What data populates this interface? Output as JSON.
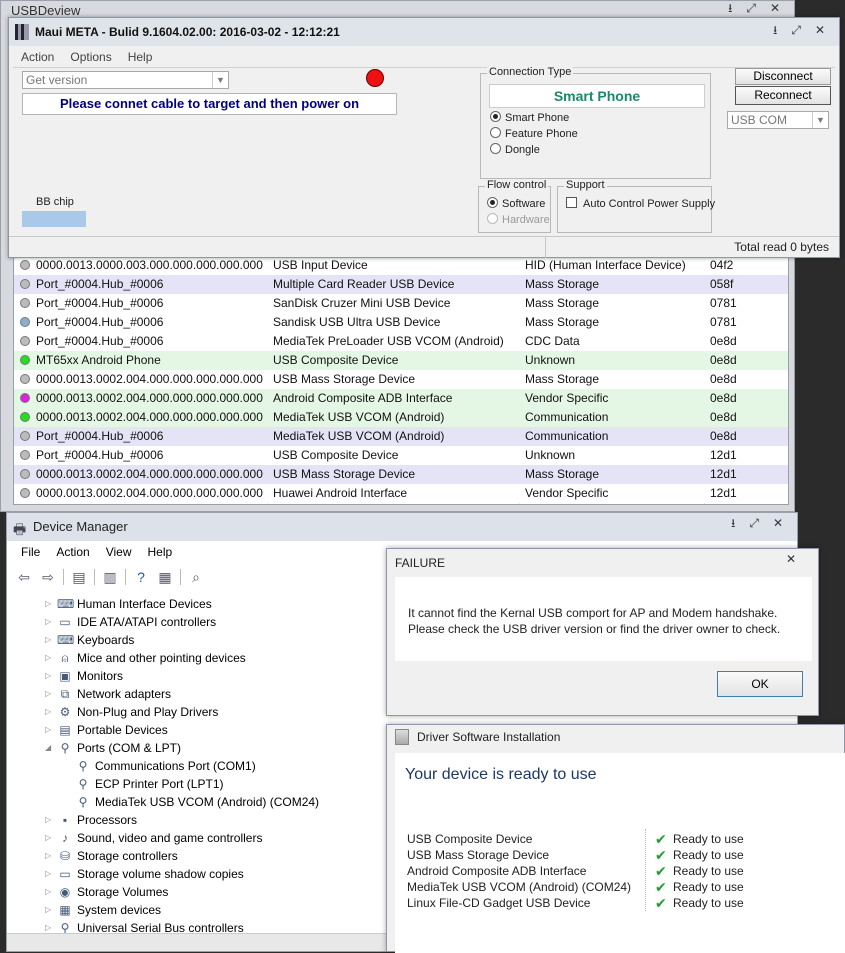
{
  "usbdeview": {
    "title": "USBDeview",
    "caption": {
      "min": "⭳",
      "restore": "⤢",
      "close": "✕"
    },
    "rows": [
      {
        "c1": "0000.0013.0000.003.000.000.000.000.000",
        "c2": "USB Input Device",
        "c3": "HID (Human Interface Device)",
        "c4": "04f2",
        "dot": "#bbbbbb",
        "bg": "#ffffff"
      },
      {
        "c1": "Port_#0004.Hub_#0006",
        "c2": "Multiple Card  Reader USB Device",
        "c3": "Mass Storage",
        "c4": "058f",
        "dot": "#bbbbbb",
        "bg": "#e4e4f6"
      },
      {
        "c1": "Port_#0004.Hub_#0006",
        "c2": "SanDisk Cruzer Mini USB Device",
        "c3": "Mass Storage",
        "c4": "0781",
        "dot": "#bbbbbb",
        "bg": "#ffffff"
      },
      {
        "c1": "Port_#0004.Hub_#0006",
        "c2": "Sandisk USB Ultra USB Device",
        "c3": "Mass Storage",
        "c4": "0781",
        "dot": "#8ab0cc",
        "bg": "#ffffff"
      },
      {
        "c1": "Port_#0004.Hub_#0006",
        "c2": "MediaTek PreLoader USB VCOM (Android)",
        "c3": "CDC Data",
        "c4": "0e8d",
        "dot": "#bbbbbb",
        "bg": "#ffffff"
      },
      {
        "c1": "MT65xx Android Phone",
        "c2": "USB Composite Device",
        "c3": "Unknown",
        "c4": "0e8d",
        "dot": "#22dd22",
        "bg": "#e4f7e4"
      },
      {
        "c1": "0000.0013.0002.004.000.000.000.000.000",
        "c2": "USB Mass Storage Device",
        "c3": "Mass Storage",
        "c4": "0e8d",
        "dot": "#bbbbbb",
        "bg": "#ffffff"
      },
      {
        "c1": "0000.0013.0002.004.000.000.000.000.000",
        "c2": "Android Composite ADB Interface",
        "c3": "Vendor Specific",
        "c4": "0e8d",
        "dot": "#dd22dd",
        "bg": "#e4f7e4"
      },
      {
        "c1": "0000.0013.0002.004.000.000.000.000.000",
        "c2": "MediaTek USB VCOM (Android)",
        "c3": "Communication",
        "c4": "0e8d",
        "dot": "#22dd22",
        "bg": "#e4f7e4"
      },
      {
        "c1": "Port_#0004.Hub_#0006",
        "c2": "MediaTek USB VCOM (Android)",
        "c3": "Communication",
        "c4": "0e8d",
        "dot": "#bbbbbb",
        "bg": "#e4e4f6"
      },
      {
        "c1": "Port_#0004.Hub_#0006",
        "c2": "USB Composite Device",
        "c3": "Unknown",
        "c4": "12d1",
        "dot": "#bbbbbb",
        "bg": "#ffffff"
      },
      {
        "c1": "0000.0013.0002.004.000.000.000.000.000",
        "c2": "USB Mass Storage Device",
        "c3": "Mass Storage",
        "c4": "12d1",
        "dot": "#bbbbbb",
        "bg": "#e4e4f6"
      },
      {
        "c1": "0000.0013.0002.004.000.000.000.000.000",
        "c2": "Huawei Android Interface",
        "c3": "Vendor Specific",
        "c4": "12d1",
        "dot": "#bbbbbb",
        "bg": "#ffffff"
      }
    ]
  },
  "maui": {
    "title": "Maui META - Bulid 9.1604.02.00: 2016-03-02 - 12:12:21",
    "menu": [
      "Action",
      "Options",
      "Help"
    ],
    "get_version": "Get version",
    "status": "Please connet cable to target and then power on",
    "bb_chip": "BB chip",
    "connection_type": {
      "legend": "Connection Type",
      "selected": "Smart Phone",
      "options": [
        "Smart Phone",
        "Feature Phone",
        "Dongle"
      ]
    },
    "flow_control": {
      "legend": "Flow control",
      "options": [
        "Software",
        "Hardware"
      ]
    },
    "support": {
      "legend": "Support",
      "auto_power": "Auto Control Power Supply"
    },
    "disconnect": "Disconnect",
    "reconnect": "Reconnect",
    "port_select": "USB COM",
    "total_read": "Total read 0 bytes",
    "indicator_color": "#ee1111"
  },
  "devmgr": {
    "title": "Device Manager",
    "menu": [
      "File",
      "Action",
      "View",
      "Help"
    ],
    "tree": [
      {
        "label": "Human Interface Devices",
        "icon": "⌨",
        "exp": "▷",
        "indent": 0
      },
      {
        "label": "IDE ATA/ATAPI controllers",
        "icon": "▭",
        "exp": "▷",
        "indent": 0
      },
      {
        "label": "Keyboards",
        "icon": "⌨",
        "exp": "▷",
        "indent": 0
      },
      {
        "label": "Mice and other pointing devices",
        "icon": "⍝",
        "exp": "▷",
        "indent": 0
      },
      {
        "label": "Monitors",
        "icon": "▣",
        "exp": "▷",
        "indent": 0
      },
      {
        "label": "Network adapters",
        "icon": "⧉",
        "exp": "▷",
        "indent": 0
      },
      {
        "label": "Non-Plug and Play Drivers",
        "icon": "⚙",
        "exp": "▷",
        "indent": 0
      },
      {
        "label": "Portable Devices",
        "icon": "▤",
        "exp": "▷",
        "indent": 0
      },
      {
        "label": "Ports (COM & LPT)",
        "icon": "⚲",
        "exp": "◢",
        "indent": 0
      },
      {
        "label": "Communications Port (COM1)",
        "icon": "⚲",
        "exp": "",
        "indent": 1
      },
      {
        "label": "ECP Printer Port (LPT1)",
        "icon": "⚲",
        "exp": "",
        "indent": 1
      },
      {
        "label": "MediaTek USB VCOM (Android) (COM24)",
        "icon": "⚲",
        "exp": "",
        "indent": 1
      },
      {
        "label": "Processors",
        "icon": "▪",
        "exp": "▷",
        "indent": 0
      },
      {
        "label": "Sound, video and game controllers",
        "icon": "♪",
        "exp": "▷",
        "indent": 0
      },
      {
        "label": "Storage controllers",
        "icon": "⛁",
        "exp": "▷",
        "indent": 0
      },
      {
        "label": "Storage volume shadow copies",
        "icon": "▭",
        "exp": "▷",
        "indent": 0
      },
      {
        "label": "Storage Volumes",
        "icon": "◉",
        "exp": "▷",
        "indent": 0
      },
      {
        "label": "System devices",
        "icon": "▦",
        "exp": "▷",
        "indent": 0
      },
      {
        "label": "Universal Serial Bus controllers",
        "icon": "⚲",
        "exp": "▷",
        "indent": 0
      }
    ]
  },
  "failure": {
    "title": "FAILURE",
    "line1": "It cannot find the Kernal USB comport for AP and Modem handshake.",
    "line2": "Please check the USB driver version or find the driver owner to check.",
    "ok": "OK"
  },
  "driver": {
    "title": "Driver Software Installation",
    "heading": "Your device is ready to use",
    "items": [
      {
        "device": "USB Composite Device",
        "status": "Ready to use"
      },
      {
        "device": "USB Mass Storage Device",
        "status": "Ready to use"
      },
      {
        "device": "Android Composite ADB Interface",
        "status": "Ready to use"
      },
      {
        "device": "MediaTek USB VCOM (Android) (COM24)",
        "status": "Ready to use"
      },
      {
        "device": "Linux File-CD Gadget USB Device",
        "status": "Ready to use"
      }
    ]
  }
}
